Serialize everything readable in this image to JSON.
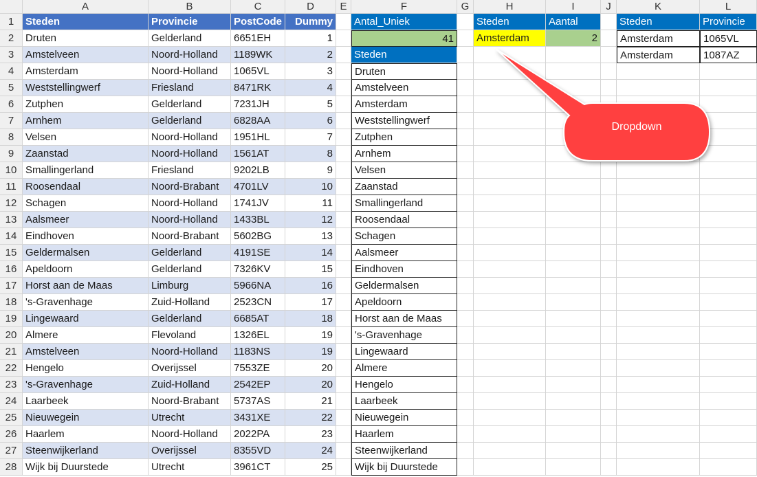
{
  "columns": [
    "A",
    "B",
    "C",
    "D",
    "E",
    "F",
    "G",
    "H",
    "I",
    "J",
    "K",
    "L"
  ],
  "rows": [
    "1",
    "2",
    "3",
    "4",
    "5",
    "6",
    "7",
    "8",
    "9",
    "10",
    "11",
    "12",
    "13",
    "14",
    "15",
    "16",
    "17",
    "18",
    "19",
    "20",
    "21",
    "22",
    "23",
    "24",
    "25",
    "26",
    "27",
    "28"
  ],
  "table_main": {
    "headers": [
      "Steden",
      "Provincie",
      "PostCode",
      "Dummy"
    ],
    "rows": [
      [
        "Druten",
        "Gelderland",
        "6651EH",
        "1"
      ],
      [
        "Amstelveen",
        "Noord-Holland",
        "1189WK",
        "2"
      ],
      [
        "Amsterdam",
        "Noord-Holland",
        "1065VL",
        "3"
      ],
      [
        "Weststellingwerf",
        "Friesland",
        "8471RK",
        "4"
      ],
      [
        "Zutphen",
        "Gelderland",
        "7231JH",
        "5"
      ],
      [
        "Arnhem",
        "Gelderland",
        "6828AA",
        "6"
      ],
      [
        "Velsen",
        "Noord-Holland",
        "1951HL",
        "7"
      ],
      [
        "Zaanstad",
        "Noord-Holland",
        "1561AT",
        "8"
      ],
      [
        "Smallingerland",
        "Friesland",
        "9202LB",
        "9"
      ],
      [
        "Roosendaal",
        "Noord-Brabant",
        "4701LV",
        "10"
      ],
      [
        "Schagen",
        "Noord-Holland",
        "1741JV",
        "11"
      ],
      [
        "Aalsmeer",
        "Noord-Holland",
        "1433BL",
        "12"
      ],
      [
        "Eindhoven",
        "Noord-Brabant",
        "5602BG",
        "13"
      ],
      [
        "Geldermalsen",
        "Gelderland",
        "4191SE",
        "14"
      ],
      [
        "Apeldoorn",
        "Gelderland",
        "7326KV",
        "15"
      ],
      [
        "Horst aan de Maas",
        "Limburg",
        "5966NA",
        "16"
      ],
      [
        "'s-Gravenhage",
        "Zuid-Holland",
        "2523CN",
        "17"
      ],
      [
        "Lingewaard",
        "Gelderland",
        "6685AT",
        "18"
      ],
      [
        "Almere",
        "Flevoland",
        "1326EL",
        "19"
      ],
      [
        "Amstelveen",
        "Noord-Holland",
        "1183NS",
        "19"
      ],
      [
        "Hengelo",
        "Overijssel",
        "7553ZE",
        "20"
      ],
      [
        "'s-Gravenhage",
        "Zuid-Holland",
        "2542EP",
        "20"
      ],
      [
        "Laarbeek",
        "Noord-Brabant",
        "5737AS",
        "21"
      ],
      [
        "Nieuwegein",
        "Utrecht",
        "3431XE",
        "22"
      ],
      [
        "Haarlem",
        "Noord-Holland",
        "2022PA",
        "23"
      ],
      [
        "Steenwijkerland",
        "Overijssel",
        "8355VD",
        "24"
      ],
      [
        "Wijk bij Duurstede",
        "Utrecht",
        "3961CT",
        "25"
      ]
    ]
  },
  "antal_uniek": {
    "label": "Antal_Uniek",
    "value": "41"
  },
  "unique_list": {
    "header": "Steden",
    "items": [
      "Druten",
      "Amstelveen",
      "Amsterdam",
      "Weststellingwerf",
      "Zutphen",
      "Arnhem",
      "Velsen",
      "Zaanstad",
      "Smallingerland",
      "Roosendaal",
      "Schagen",
      "Aalsmeer",
      "Eindhoven",
      "Geldermalsen",
      "Apeldoorn",
      "Horst aan de Maas",
      "'s-Gravenhage",
      "Lingewaard",
      "Almere",
      "Hengelo",
      "Laarbeek",
      "Nieuwegein",
      "Haarlem",
      "Steenwijkerland",
      "Wijk bij Duurstede"
    ]
  },
  "lookup": {
    "header_steden": "Steden",
    "header_aantal": "Aantal",
    "selected": "Amsterdam",
    "count": "2"
  },
  "results": {
    "headers": [
      "Steden",
      "Provincie"
    ],
    "rows": [
      [
        "Amsterdam",
        "1065VL"
      ],
      [
        "Amsterdam",
        "1087AZ"
      ]
    ]
  },
  "callout": {
    "text": "Dropdown",
    "color": "#ff4040"
  },
  "colors": {
    "header_blue": "#4472c4",
    "band": "#d9e1f2",
    "table_blue": "#0070c0",
    "green": "#a9d08e",
    "yellow": "#ffff00"
  }
}
